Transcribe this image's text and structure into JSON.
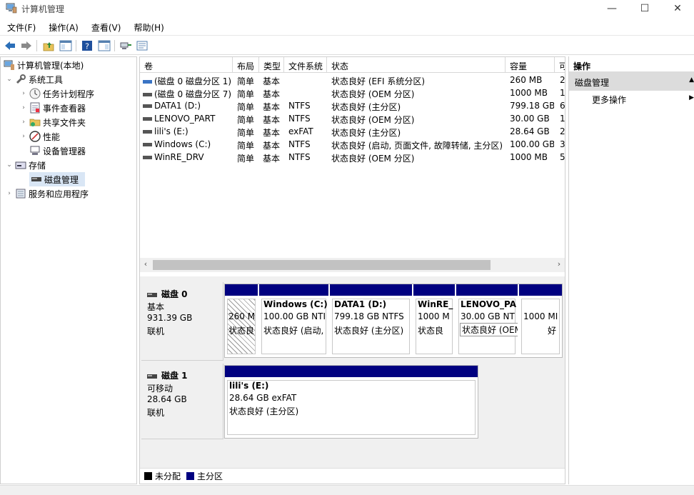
{
  "window": {
    "title": "计算机管理",
    "min": "—",
    "max": "☐",
    "close": "✕"
  },
  "menu": [
    "文件(F)",
    "操作(A)",
    "查看(V)",
    "帮助(H)"
  ],
  "toolbar_icons": [
    "back-icon",
    "forward-icon",
    "up-folder-icon",
    "show-hide-tree-icon",
    "help-icon",
    "properties-icon",
    "connect-icon",
    "export-icon"
  ],
  "tree": {
    "root": "计算机管理(本地)",
    "system_tools": "系统工具",
    "task_scheduler": "任务计划程序",
    "event_viewer": "事件查看器",
    "shared_folders": "共享文件夹",
    "performance": "性能",
    "device_manager": "设备管理器",
    "storage": "存储",
    "disk_management": "磁盘管理",
    "services_apps": "服务和应用程序"
  },
  "volumes": {
    "columns": [
      "卷",
      "布局",
      "类型",
      "文件系统",
      "状态",
      "容量",
      "可"
    ],
    "rows": [
      [
        "(磁盘 0 磁盘分区 1)",
        "简单",
        "基本",
        "",
        "状态良好 (EFI 系统分区)",
        "260 MB",
        "2"
      ],
      [
        "(磁盘 0 磁盘分区 7)",
        "简单",
        "基本",
        "",
        "状态良好 (OEM 分区)",
        "1000 MB",
        "1"
      ],
      [
        "DATA1 (D:)",
        "简单",
        "基本",
        "NTFS",
        "状态良好 (主分区)",
        "799.18 GB",
        "6"
      ],
      [
        "LENOVO_PART",
        "简单",
        "基本",
        "NTFS",
        "状态良好 (OEM 分区)",
        "30.00 GB",
        "1"
      ],
      [
        "lili's (E:)",
        "简单",
        "基本",
        "exFAT",
        "状态良好 (主分区)",
        "28.64 GB",
        "2"
      ],
      [
        "Windows (C:)",
        "简单",
        "基本",
        "NTFS",
        "状态良好 (启动, 页面文件, 故障转储, 主分区)",
        "100.00 GB",
        "3"
      ],
      [
        "WinRE_DRV",
        "简单",
        "基本",
        "NTFS",
        "状态良好 (OEM 分区)",
        "1000 MB",
        "5"
      ]
    ]
  },
  "disks": [
    {
      "name": "磁盘 0",
      "type": "基本",
      "size": "931.39 GB",
      "status": "联机",
      "partitions": [
        {
          "name": "",
          "size": "260 M",
          "status": "状态良",
          "hatched": true
        },
        {
          "name": "Windows (C:)",
          "size": "100.00 GB NTI",
          "status": "状态良好 (启动,"
        },
        {
          "name": "DATA1 (D:)",
          "size": "799.18 GB NTFS",
          "status": "状态良好 (主分区)"
        },
        {
          "name": "WinRE_",
          "size": "1000 M",
          "status": "状态良"
        },
        {
          "name": "LENOVO_PA",
          "size": "30.00 GB NT",
          "status": "状态良好 (OEM 分区)"
        },
        {
          "name": "",
          "size": "1000 MI",
          "status": "好"
        }
      ]
    },
    {
      "name": "磁盘 1",
      "type": "可移动",
      "size": "28.64 GB",
      "status": "联机",
      "partitions": [
        {
          "name": "lili's (E:)",
          "size": "28.64 GB exFAT",
          "status": "状态良好 (主分区)"
        }
      ]
    }
  ],
  "legend": {
    "unallocated": "未分配",
    "primary": "主分区",
    "unallocated_color": "#000000",
    "primary_color": "#000080"
  },
  "actions": {
    "header": "操作",
    "section": "磁盘管理",
    "more": "更多操作"
  }
}
